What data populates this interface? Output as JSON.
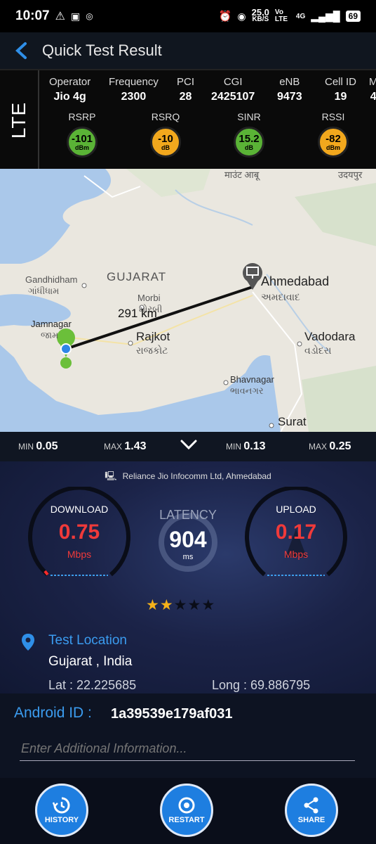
{
  "status_bar": {
    "time": "10:07",
    "speed_value": "25.0",
    "speed_unit": "KB/S",
    "network": "Vo LTE",
    "network_type": "4G",
    "battery": "69"
  },
  "header": {
    "title": "Quick Test Result"
  },
  "lte": {
    "tech": "LTE",
    "columns": [
      {
        "label": "Operator",
        "value": "Jio 4g"
      },
      {
        "label": "Frequency",
        "value": "2300"
      },
      {
        "label": "PCI",
        "value": "28"
      },
      {
        "label": "CGI",
        "value": "2425107"
      },
      {
        "label": "eNB",
        "value": "9473"
      },
      {
        "label": "Cell ID",
        "value": "19"
      },
      {
        "label": "M",
        "value": "4"
      }
    ],
    "signals": [
      {
        "label": "RSRP",
        "value": "-101",
        "unit": "dBm",
        "color": "#5ab336"
      },
      {
        "label": "RSRQ",
        "value": "-10",
        "unit": "dB",
        "color": "#f2a81d"
      },
      {
        "label": "SINR",
        "value": "15.2",
        "unit": "dB",
        "color": "#5ab336"
      },
      {
        "label": "RSSI",
        "value": "-82",
        "unit": "dBm",
        "color": "#f2a81d"
      }
    ]
  },
  "map": {
    "labels": {
      "mount_abu": "माउंट आबू",
      "udaipur": "उदयपुर",
      "gujarat": "GUJARAT",
      "gandhidham": "Gandhidham",
      "gandhidham_gu": "ગાંધીધામ",
      "morbi": "Morbi",
      "morbi_gu": "મોરબી",
      "distance": "291 km",
      "ahmedabad": "Ahmedabad",
      "ahmedabad_gu": "અમદાવાદ",
      "jamnagar": "Jamnagar",
      "jamnagar_gu": "જામ",
      "rajkot": "Rajkot",
      "rajkot_gu": "રાજકોટ",
      "vadodara": "Vadodara",
      "vadodara_gu": "વડોદરા",
      "bhavnagar": "Bhavnagar",
      "bhavnagar_gu": "ભાવનગર",
      "surat": "Surat"
    }
  },
  "minmax": {
    "download_min_label": "MIN",
    "download_min": "0.05",
    "download_max_label": "MAX",
    "download_max": "1.43",
    "upload_min_label": "MIN",
    "upload_min": "0.13",
    "upload_max_label": "MAX",
    "upload_max": "0.25"
  },
  "speed": {
    "isp": "Reliance Jio Infocomm Ltd, Ahmedabad",
    "download_label": "DOWNLOAD",
    "download_value": "0.75",
    "download_unit": "Mbps",
    "latency_label": "LATENCY",
    "latency_value": "904",
    "latency_unit": "ms",
    "upload_label": "UPLOAD",
    "upload_value": "0.17",
    "upload_unit": "Mbps",
    "rating": 2,
    "rating_max": 5
  },
  "location": {
    "title": "Test Location",
    "place": "Gujarat , India",
    "lat": "Lat : 22.225685",
    "long": "Long : 69.886795"
  },
  "android": {
    "label": "Android ID :",
    "value": "1a39539e179af031",
    "placeholder": "Enter Additional Information..."
  },
  "actions": {
    "history": "HISTORY",
    "restart": "RESTART",
    "share": "SHARE"
  }
}
